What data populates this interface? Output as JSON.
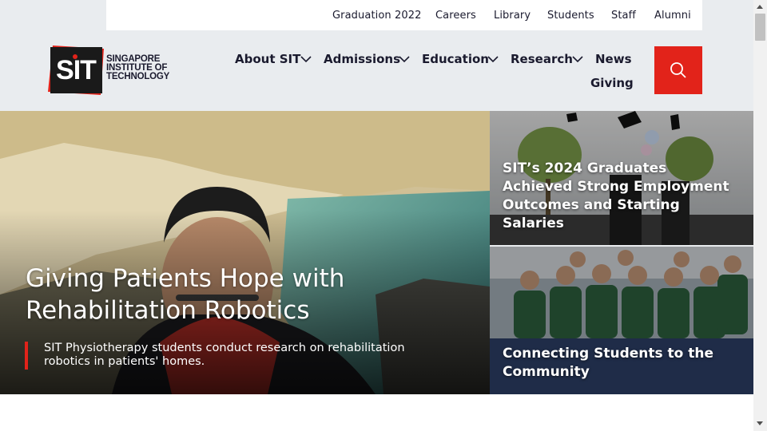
{
  "utility_nav": [
    {
      "label": "Graduation 2022"
    },
    {
      "label": "Careers"
    },
    {
      "label": "Library"
    },
    {
      "label": "Students"
    },
    {
      "label": "Staff"
    },
    {
      "label": "Alumni"
    }
  ],
  "logo": {
    "mark": "SIT",
    "line1": "SINGAPORE",
    "line2": "INSTITUTE OF",
    "line3": "TECHNOLOGY"
  },
  "main_nav": {
    "about": "About SIT",
    "admissions": "Admissions",
    "education": "Education",
    "research": "Research",
    "news": "News",
    "giving": "Giving"
  },
  "search": {
    "icon": "search-icon"
  },
  "hero": {
    "title": "Giving Patients Hope with Rehabilitation Robotics",
    "subtitle": "SIT Physiotherapy students conduct research on rehabilitation robotics in patients' homes."
  },
  "cards": [
    {
      "title": "SIT’s 2024 Graduates Achieved Strong Employment Outcomes and Starting Salaries"
    },
    {
      "title": "Connecting Students to the Community"
    }
  ],
  "colors": {
    "accent": "#e2231a",
    "header_bg": "#e9ecef",
    "text": "#1a1a2e"
  }
}
